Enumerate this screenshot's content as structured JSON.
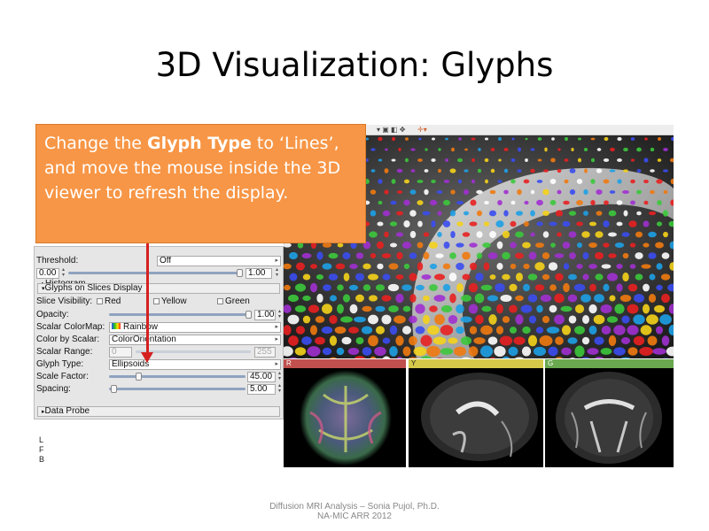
{
  "slide": {
    "title": "3D Visualization: Glyphs",
    "footer_line1": "Diffusion MRI Analysis – Sonia Pujol, Ph.D.",
    "footer_line2": "NA-MIC ARR 2012"
  },
  "callout": {
    "part1": "Change  the ",
    "bold": "Glyph Type",
    "part2": " to ‘Lines’, and move the  mouse inside the 3D viewer to refresh the display."
  },
  "panel": {
    "threshold_label": "Threshold:",
    "threshold_value": "Off",
    "range_min": "0.00",
    "range_max": "1.00",
    "histogram_label": "Histogram",
    "glyphs_section": "Glyphs on Slices Display",
    "slice_visibility_label": "Slice Visibility:",
    "slice_red": "Red",
    "slice_yellow": "Yellow",
    "slice_green": "Green",
    "opacity_label": "Opacity:",
    "opacity_value": "1.00",
    "colormap_label": "Scalar ColorMap:",
    "colormap_value": "Rainbow",
    "color_by_label": "Color by Scalar:",
    "color_by_value": "ColorOrientation",
    "scalar_range_label": "Scalar Range:",
    "scalar_range_min": "0",
    "scalar_range_max": "255",
    "glyph_type_label": "Glyph Type:",
    "glyph_type_value": "Ellipsoids",
    "scale_factor_label": "Scale Factor:",
    "scale_factor_value": "45.00",
    "spacing_label": "Spacing:",
    "spacing_value": "5.00",
    "data_probe_label": "Data Probe"
  },
  "slices": [
    {
      "name": "R",
      "color": "#c0504d"
    },
    {
      "name": "Y",
      "color": "#d6c94a"
    },
    {
      "name": "G",
      "color": "#6aa84f"
    }
  ],
  "orientation_letters": [
    "L",
    "F",
    "B"
  ],
  "colors": {
    "callout_bg": "#f79646",
    "arrow": "#d62020"
  },
  "icons": {
    "toolbar": [
      "layout-icon",
      "view-icon",
      "crosshair-icon"
    ]
  }
}
